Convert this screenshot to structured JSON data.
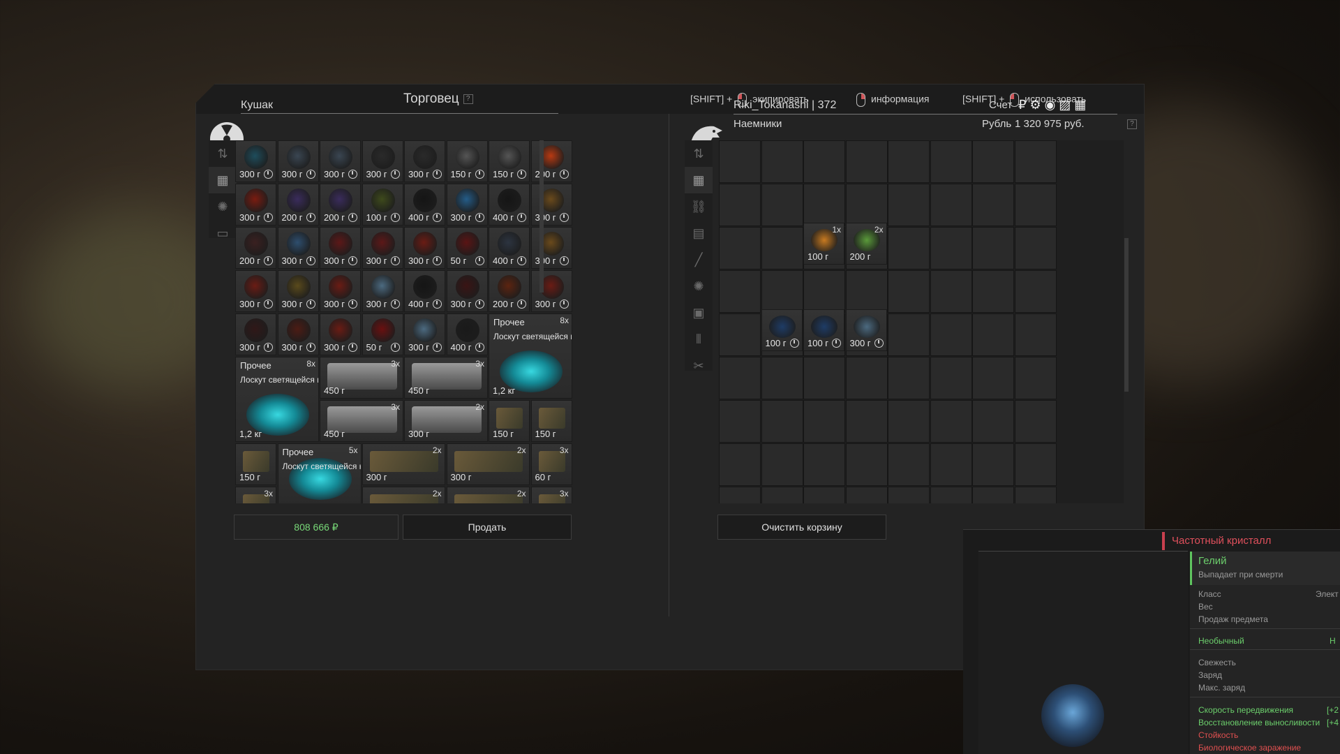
{
  "trader": {
    "title": "Торговец",
    "help": "?",
    "npc_name": "Кушак"
  },
  "hints": [
    {
      "prefix": "[SHIFT] +",
      "mouse": "left",
      "label": "экипировать"
    },
    {
      "prefix": "",
      "mouse": "right",
      "label": "информация"
    },
    {
      "prefix": "[SHIFT] +",
      "mouse": "left",
      "label": "использовать"
    }
  ],
  "player": {
    "name_level": "Riki_Tokanashi | 372",
    "faction": "Наемники",
    "account_label": "Счет",
    "currency_label": "Рубль",
    "balance": "1 320 975 руб.",
    "help": "?"
  },
  "colors": {
    "accent_red": "#c8404e",
    "accent_green": "#6ccf6c",
    "panel": "#232323"
  },
  "left_sidebar_icons": [
    "sort-icon",
    "grid-icon",
    "artifact-icon",
    "container-icon"
  ],
  "right_sidebar_icons": [
    "sort-icon",
    "grid-icon",
    "link-icon",
    "armor-icon",
    "rifle-icon",
    "artifact-icon",
    "medkit-icon",
    "ammo-icon",
    "tools-icon",
    "container-icon"
  ],
  "trader_items": [
    [
      "300 г",
      "300 г",
      "300 г",
      "300 г",
      "300 г",
      "150 г",
      "150 г",
      "200 г"
    ],
    [
      "300 г",
      "200 г",
      "200 г",
      "100 г",
      "400 г",
      "300 г",
      "400 г",
      "300 г"
    ],
    [
      "200 г",
      "300 г",
      "300 г",
      "300 г",
      "300 г",
      "50 г",
      "400 г",
      "300 г"
    ],
    [
      "300 г",
      "300 г",
      "300 г",
      "300 г",
      "400 г",
      "300 г",
      "200 г",
      "300 г"
    ],
    [
      "300 г",
      "300 г",
      "300 г",
      "50 г",
      "300 г",
      "400 г"
    ]
  ],
  "trader_big_items": [
    {
      "category": "Прочее",
      "count": "8x",
      "name": "Лоскут светящейся кож...",
      "weight": "1,2 кг"
    },
    {
      "category": "Прочее",
      "count": "8x",
      "name": "Лоскут светящейся кож...",
      "weight": "1,2 кг"
    },
    {
      "category": "Прочее",
      "count": "5x",
      "name": "Лоскут светящейся кож...",
      "weight": ""
    }
  ],
  "trader_containers": [
    {
      "count": "3x",
      "weight": "450 г"
    },
    {
      "count": "3x",
      "weight": "450 г"
    },
    {
      "count": "3x",
      "weight": "450 г"
    },
    {
      "count": "2x",
      "weight": "300 г"
    }
  ],
  "trader_misc": [
    {
      "count": "",
      "weight": "150 г"
    },
    {
      "count": "",
      "weight": "150 г"
    },
    {
      "count": "",
      "weight": "150 г"
    },
    {
      "count": "2x",
      "weight": "300 г"
    },
    {
      "count": "2x",
      "weight": "300 г"
    },
    {
      "count": "3x",
      "weight": "60 г"
    },
    {
      "count": "3x",
      "weight": ""
    },
    {
      "count": "2x",
      "weight": ""
    },
    {
      "count": "2x",
      "weight": ""
    },
    {
      "count": "3x",
      "weight": ""
    }
  ],
  "cart_items": [
    {
      "count": "1x",
      "weight": "100 г"
    },
    {
      "count": "2x",
      "weight": "200 г"
    },
    {
      "count": "",
      "weight": "100 г"
    },
    {
      "count": "",
      "weight": "100 г"
    },
    {
      "count": "",
      "weight": "300 г"
    }
  ],
  "footer": {
    "total": "808 666 ₽",
    "sell": "Продать",
    "clear": "Очистить корзину"
  },
  "tooltip": {
    "title": "Частотный кристалл",
    "subtitle": "Гелий",
    "drop_note": "Выпадает при смерти",
    "class_label": "Класс",
    "class_value": "Элект",
    "weight_label": "Вес",
    "sale_label": "Продаж предмета",
    "rarity": "Необычный",
    "rarity_short": "Н",
    "freshness": "Свежесть",
    "charge": "Заряд",
    "max_charge": "Макс. заряд",
    "stats": [
      {
        "label": "Скорость передвижения",
        "value": "[+2",
        "color": "green"
      },
      {
        "label": "Восстановление выносливости",
        "value": "[+4",
        "color": "green"
      },
      {
        "label": "Стойкость",
        "value": "",
        "color": "red"
      },
      {
        "label": "Биологическое заражение",
        "value": "",
        "color": "red"
      }
    ]
  }
}
